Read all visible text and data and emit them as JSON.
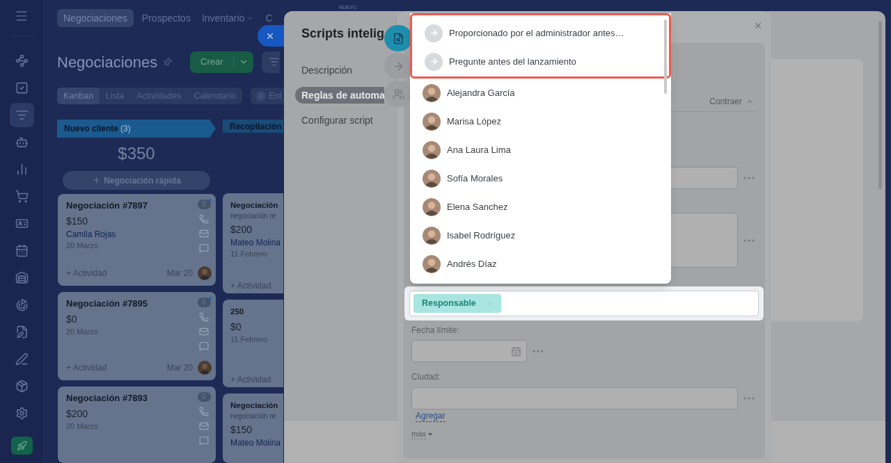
{
  "badge_new": "NUEVO",
  "sidebar": {
    "items": [
      {
        "kind": "network",
        "selected": false
      },
      {
        "kind": "tasks",
        "selected": false
      },
      {
        "kind": "funnel",
        "selected": true
      },
      {
        "kind": "robot",
        "selected": false
      },
      {
        "kind": "chart",
        "selected": false
      },
      {
        "kind": "cart",
        "selected": false
      },
      {
        "kind": "card",
        "selected": false
      },
      {
        "kind": "calendar",
        "selected": false
      },
      {
        "kind": "warehouse",
        "selected": false
      },
      {
        "kind": "target",
        "selected": false
      },
      {
        "kind": "document",
        "selected": false
      },
      {
        "kind": "pen",
        "selected": false
      },
      {
        "kind": "box",
        "selected": false
      },
      {
        "kind": "settings",
        "selected": false
      }
    ]
  },
  "top_tabs": [
    {
      "label": "Negociaciones",
      "selected": true,
      "has_menu": false
    },
    {
      "label": "Prospectos",
      "selected": false,
      "has_menu": false
    },
    {
      "label": "Inventario",
      "selected": false,
      "has_menu": true
    },
    {
      "label": "C",
      "selected": false,
      "has_menu": false
    }
  ],
  "page_title": "Negociaciones",
  "create_button": "Crear",
  "view_tabs": [
    {
      "label": "Kanban",
      "selected": true
    },
    {
      "label": "Lista",
      "selected": false
    },
    {
      "label": "Actividades",
      "selected": false
    },
    {
      "label": "Calendario",
      "selected": false
    }
  ],
  "counter": {
    "count": "0",
    "label": "Ent"
  },
  "columns": [
    {
      "title": "Nuevo cliente",
      "count": "(3)",
      "total": "$350",
      "quick_add": "Negociación rápida",
      "cards": [
        {
          "title": "Negociación #7897",
          "amount": "$150",
          "contact": "Camila Rojas",
          "date": "20 Marzo",
          "activity": "+ Actividad",
          "due": "Mar 20",
          "badge": "0",
          "unread": true
        },
        {
          "title": "Negociación #7895",
          "amount": "$0",
          "date": "20 Marzo",
          "activity": "+ Actividad",
          "due": "Mar 20",
          "badge": "0",
          "unread": true
        },
        {
          "title": "Negociación #7893",
          "amount": "$200",
          "date": "20 Marzo",
          "badge": "0",
          "unread": false
        }
      ]
    },
    {
      "title": "Recopilación",
      "cards": [
        {
          "title": "Negociación",
          "note": "negociación re",
          "amount": "$200",
          "contact": "Mateo Molina",
          "date": "11 Febrero",
          "activity": "+ Actividad"
        },
        {
          "title": "250",
          "amount": "$0",
          "date": "11 Febrero",
          "activity": "+ Actividad"
        },
        {
          "title": "Negociación",
          "note": "negociación re",
          "amount": "$150",
          "contact": "Mateo Molina"
        }
      ]
    }
  ],
  "slider": {
    "title": "Scripts intelig",
    "nav": [
      {
        "label": "Descripción",
        "selected": false
      },
      {
        "label": "Reglas de automa",
        "selected": true
      },
      {
        "label": "Configurar script",
        "selected": false
      }
    ],
    "side_tabs": [
      {
        "kind": "search",
        "selected": true
      },
      {
        "kind": "arrow",
        "selected": false
      },
      {
        "kind": "users",
        "selected": false
      }
    ]
  },
  "form": {
    "collapse": "Contraer",
    "responsible": {
      "tag": "Responsable",
      "highlighted": true
    },
    "deadline": {
      "label": "Fecha límite:"
    },
    "city": {
      "label": "Ciudad:",
      "add_link": "Agregar"
    },
    "more": "más"
  },
  "dropdown": {
    "options": [
      {
        "kind": "source",
        "label": "Proporcionado por el administrador antes…",
        "highlighted": true
      },
      {
        "kind": "source",
        "label": "Pregunte antes del lanzamiento",
        "highlighted": true
      },
      {
        "kind": "person",
        "label": "Alejandra García",
        "highlighted": false
      },
      {
        "kind": "person",
        "label": "Marisa López",
        "highlighted": false
      },
      {
        "kind": "person",
        "label": "Ana Laura Lima",
        "highlighted": false
      },
      {
        "kind": "person",
        "label": "Sofía Morales",
        "highlighted": false
      },
      {
        "kind": "person",
        "label": "Elena Sanchez",
        "highlighted": false
      },
      {
        "kind": "person",
        "label": "Isabel Rodríguez",
        "highlighted": false
      },
      {
        "kind": "person",
        "label": "Andrés Díaz",
        "highlighted": false
      }
    ]
  }
}
